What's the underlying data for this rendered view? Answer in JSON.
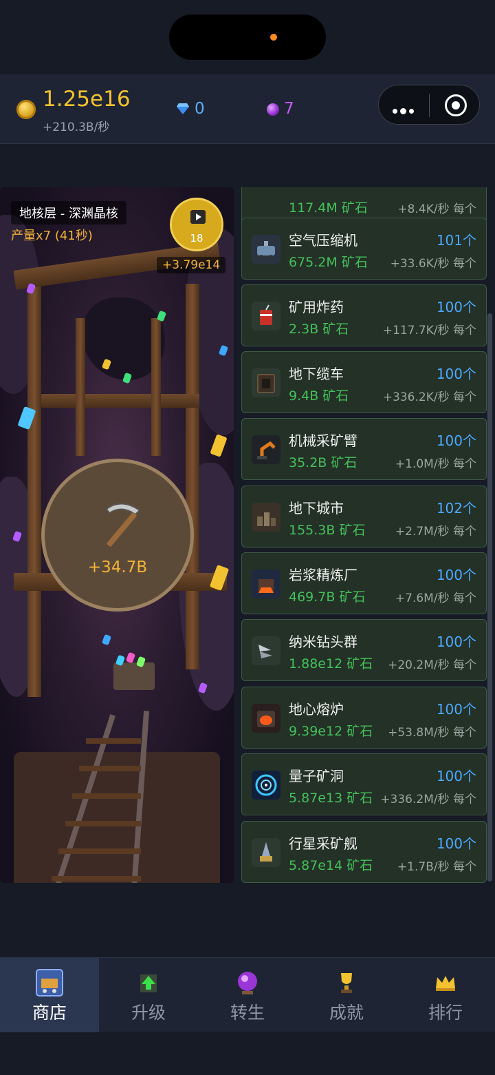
{
  "topbar": {
    "coin_value": "1.25e16",
    "coin_rate": "+210.3B/秒",
    "diamond_value": "0",
    "orb_value": "7"
  },
  "mine": {
    "level_label": "地核层 - 深渊晶核",
    "production_label": "产量x7 (41秒)",
    "video_count": "18",
    "video_reward": "+3.79e14",
    "click_amount": "+34.7B"
  },
  "shop": {
    "items": [
      {
        "name": "",
        "count": "",
        "cost": "117.4M 矿石",
        "rate": "+8.4K/秒 每个",
        "icon": "partial-item-icon"
      },
      {
        "name": "空气压缩机",
        "count": "101个",
        "cost": "675.2M 矿石",
        "rate": "+33.6K/秒 每个",
        "icon": "air-compressor-icon"
      },
      {
        "name": "矿用炸药",
        "count": "100个",
        "cost": "2.3B 矿石",
        "rate": "+117.7K/秒 每个",
        "icon": "dynamite-icon"
      },
      {
        "name": "地下缆车",
        "count": "100个",
        "cost": "9.4B 矿石",
        "rate": "+336.2K/秒 每个",
        "icon": "cable-car-icon"
      },
      {
        "name": "机械采矿臂",
        "count": "100个",
        "cost": "35.2B 矿石",
        "rate": "+1.0M/秒 每个",
        "icon": "robot-arm-icon"
      },
      {
        "name": "地下城市",
        "count": "102个",
        "cost": "155.3B 矿石",
        "rate": "+2.7M/秒 每个",
        "icon": "underground-city-icon"
      },
      {
        "name": "岩浆精炼厂",
        "count": "100个",
        "cost": "469.7B 矿石",
        "rate": "+7.6M/秒 每个",
        "icon": "magma-refinery-icon"
      },
      {
        "name": "纳米钻头群",
        "count": "100个",
        "cost": "1.88e12 矿石",
        "rate": "+20.2M/秒 每个",
        "icon": "nano-drill-icon"
      },
      {
        "name": "地心熔炉",
        "count": "100个",
        "cost": "9.39e12 矿石",
        "rate": "+53.8M/秒 每个",
        "icon": "core-furnace-icon"
      },
      {
        "name": "量子矿洞",
        "count": "100个",
        "cost": "5.87e13 矿石",
        "rate": "+336.2M/秒 每个",
        "icon": "quantum-mine-icon"
      },
      {
        "name": "行星采矿舰",
        "count": "100个",
        "cost": "5.87e14 矿石",
        "rate": "+1.7B/秒 每个",
        "icon": "planet-miner-icon"
      }
    ]
  },
  "nav": {
    "items": [
      {
        "label": "商店",
        "icon": "shop-cart-icon"
      },
      {
        "label": "升级",
        "icon": "upgrade-arrow-icon"
      },
      {
        "label": "转生",
        "icon": "rebirth-orb-icon"
      },
      {
        "label": "成就",
        "icon": "trophy-icon"
      },
      {
        "label": "排行",
        "icon": "crown-icon"
      }
    ],
    "active": "商店"
  },
  "colors": {
    "gold": "#f2c230",
    "diamond": "#5ab0ff",
    "orb": "#c35cf0",
    "cost_green": "#46c05a",
    "count_blue": "#4fa9ff"
  }
}
